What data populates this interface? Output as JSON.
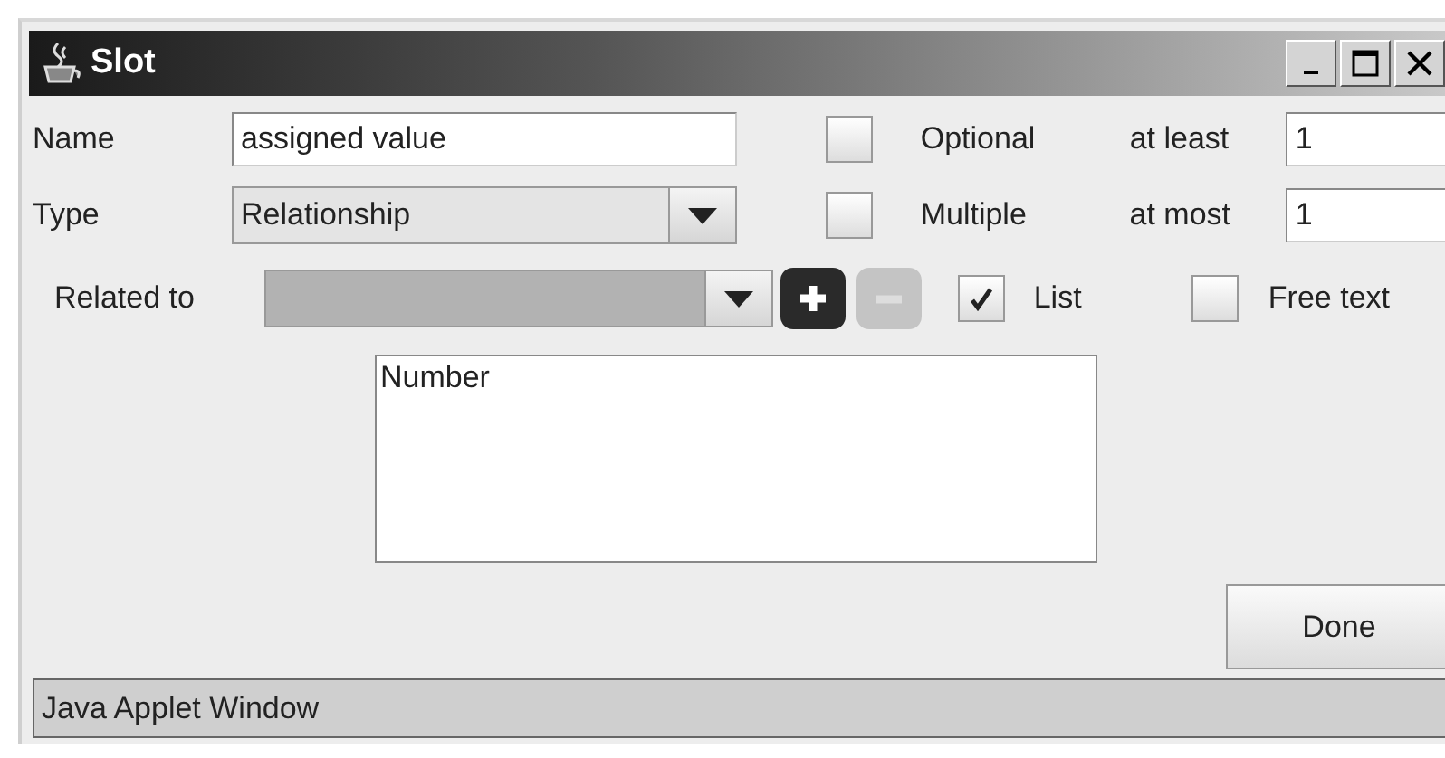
{
  "window": {
    "title": "Slot"
  },
  "name_row": {
    "label": "Name",
    "value": "assigned value",
    "checkbox": {
      "label": "Optional",
      "checked": false
    },
    "bound_label": "at least",
    "bound_value": "1"
  },
  "type_row": {
    "label": "Type",
    "value": "Relationship",
    "checkbox": {
      "label": "Multiple",
      "checked": false
    },
    "bound_label": "at most",
    "bound_value": "1"
  },
  "related_row": {
    "label": "Related to",
    "combo_disabled": true,
    "add_disabled": false,
    "remove_disabled": true,
    "checkboxes": [
      {
        "label": "List",
        "checked": true
      },
      {
        "label": "Free text",
        "checked": false
      }
    ]
  },
  "related_list": {
    "items": [
      {
        "label": "Number",
        "selected": false
      }
    ]
  },
  "buttons": [
    "Done"
  ],
  "status_bar": "Java Applet Window"
}
